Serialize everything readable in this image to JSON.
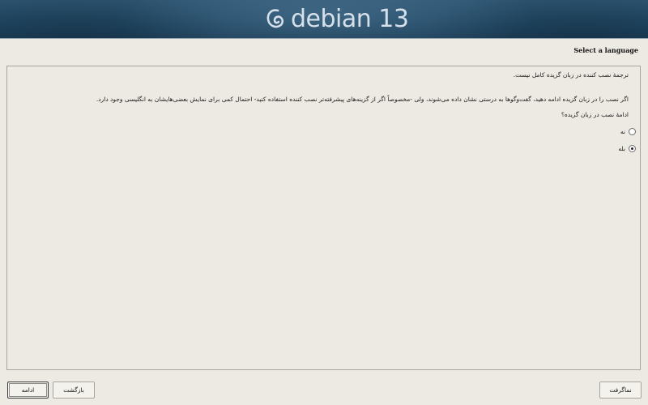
{
  "banner": {
    "logo_text": "debian 13",
    "logo_icon": "debian-swirl-icon"
  },
  "step": {
    "title": "Select a language"
  },
  "content": {
    "line1": "ترجمهٔ نصب کننده در زبان گزیده کامل نیست.",
    "line2": "اگر نصب را در زبان گزیده ادامه دهید، گفت‌وگوها به درستی نشان داده می‌شوند، ولی -مخصوصاً اگر از گزینه‌های پیشرفته‌تر نصب کننده استفاده کنید- احتمال کمی برای نمایش بعضی‌هایشان به انگلیسی وجود دارد.",
    "question": "ادامهٔ نصب در زبان گزیده؟",
    "options": [
      {
        "label": "نه",
        "selected": false
      },
      {
        "label": "بله",
        "selected": true
      }
    ]
  },
  "buttons": {
    "continue": "ادامه",
    "back": "بازگشت",
    "screenshot": "نماگرفت"
  }
}
